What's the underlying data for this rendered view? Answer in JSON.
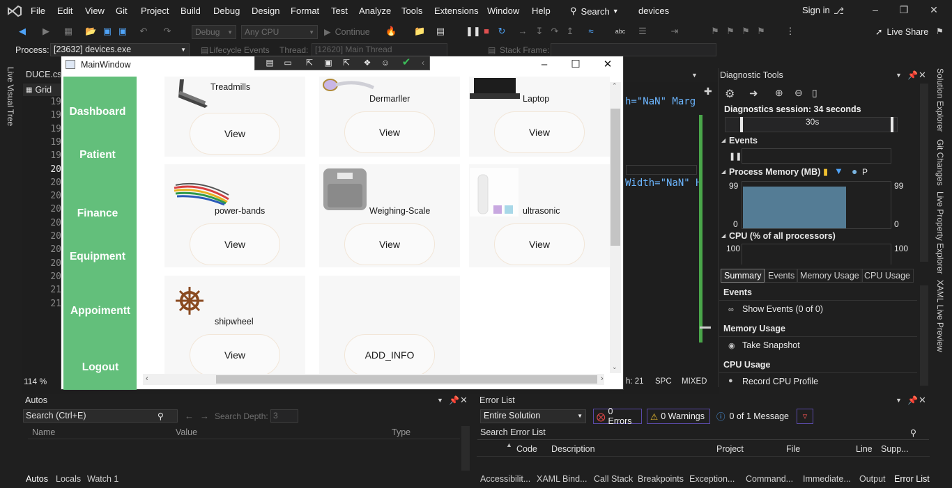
{
  "menubar": {
    "items": [
      "File",
      "Edit",
      "View",
      "Git",
      "Project",
      "Build",
      "Debug",
      "Design",
      "Format",
      "Test",
      "Analyze",
      "Tools",
      "Extensions",
      "Window",
      "Help"
    ],
    "search": "Search",
    "solution": "devices",
    "signin": "Sign in"
  },
  "toolbar": {
    "config": "Debug",
    "platform": "Any CPU",
    "continue": "Continue",
    "liveshare": "Live Share"
  },
  "procbar": {
    "process_label": "Process:",
    "process_value": "[23632] devices.exe",
    "lifecycle": "Lifecycle Events",
    "thread_label": "Thread:",
    "thread_value": "[12620] Main Thread",
    "stackframe": "Stack Frame:"
  },
  "left_strip": {
    "live_visual_tree": "Live Visual Tree"
  },
  "editor": {
    "tab": "DUCE.cs",
    "crumb": "Grid",
    "line_numbers": [
      "19",
      "19",
      "19",
      "19",
      "19",
      "20",
      "20",
      "20",
      "20",
      "20",
      "20",
      "20",
      "20",
      "20",
      "21",
      "21"
    ],
    "code1": "h=\"NaN\" Marg",
    "code2": "Width=\"NaN\" H",
    "zoom": "114 %",
    "status_ln": "h: 21",
    "status_spc": "SPC",
    "status_mixed": "MIXED"
  },
  "diagnostic": {
    "title": "Diagnostic Tools",
    "session": "Diagnostics session: 34 seconds",
    "timeline_label": "30s",
    "events": "Events",
    "process_memory": "Process Memory (MB)",
    "pm_legend_p": "P",
    "mem_max_left": "99",
    "mem_max_right": "99",
    "mem_min_left": "0",
    "mem_min_right": "0",
    "cpu": "CPU (% of all processors)",
    "cpu_max_left": "100",
    "cpu_max_right": "100",
    "tabs": [
      "Summary",
      "Events",
      "Memory Usage",
      "CPU Usage"
    ],
    "group_events": "Events",
    "show_events": "Show Events (0 of 0)",
    "group_memory": "Memory Usage",
    "take_snapshot": "Take Snapshot",
    "group_cpu": "CPU Usage",
    "record_cpu": "Record CPU Profile"
  },
  "right_strip": [
    "Solution Explorer",
    "Git Changes",
    "Live Property Explorer",
    "XAML Live Preview"
  ],
  "autos": {
    "title": "Autos",
    "search_placeholder": "Search (Ctrl+E)",
    "search_depth": "Search Depth:",
    "depth_value": "3",
    "columns": [
      "Name",
      "Value",
      "Type"
    ],
    "bottom_tabs": [
      "Autos",
      "Locals",
      "Watch 1"
    ]
  },
  "errorlist": {
    "title": "Error List",
    "scope": "Entire Solution",
    "errors": "0 Errors",
    "warnings": "0 Warnings",
    "messages": "0 of 1 Message",
    "search": "Search Error List",
    "columns": [
      "Code",
      "Description",
      "Project",
      "File",
      "Line",
      "Supp..."
    ],
    "bottom_tabs": [
      "Accessibilit...",
      "XAML Bind...",
      "Call Stack",
      "Breakpoints",
      "Exception...",
      "Command...",
      "Immediate...",
      "Output",
      "Error List"
    ]
  },
  "mainwindow": {
    "title": "MainWindow",
    "nav": [
      "Dashboard",
      "Patient",
      "Finance",
      "Equipment",
      "Appoimentt",
      "Logout"
    ],
    "cards": [
      {
        "label": "Treadmills",
        "button": "View"
      },
      {
        "label": "Dermarller",
        "button": "View"
      },
      {
        "label": "Laptop",
        "button": "View"
      },
      {
        "label": "power-bands",
        "button": "View"
      },
      {
        "label": "Weighing-Scale",
        "button": "View"
      },
      {
        "label": "ultrasonic",
        "button": "View"
      },
      {
        "label": "shipwheel",
        "button": "View"
      },
      {
        "label": "",
        "button": "ADD_INFO"
      }
    ]
  },
  "colors": {
    "sidebar_green": "#63bf7b",
    "memory_fill": "#547c95",
    "vs_bg": "#1f1f1f"
  }
}
